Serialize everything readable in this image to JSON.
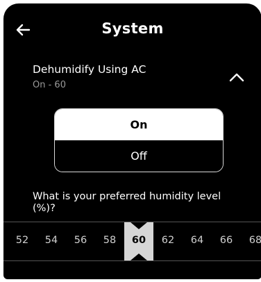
{
  "header": {
    "title": "System",
    "back_icon": "back-arrow-icon"
  },
  "setting": {
    "label": "Dehumidify Using AC",
    "summary": "On - 60",
    "expanded": true,
    "chevron_icon": "chevron-up-icon"
  },
  "segment": {
    "options": [
      "On",
      "Off"
    ],
    "selected": "On"
  },
  "humidity": {
    "question": "What is your preferred humidity level (%)?",
    "values": [
      "52",
      "54",
      "56",
      "58",
      "60",
      "62",
      "64",
      "66",
      "68"
    ],
    "selected": "60"
  },
  "colors": {
    "background": "#000000",
    "text": "#ffffff",
    "muted": "#9a9a9a",
    "selector": "#d6d6d6"
  }
}
